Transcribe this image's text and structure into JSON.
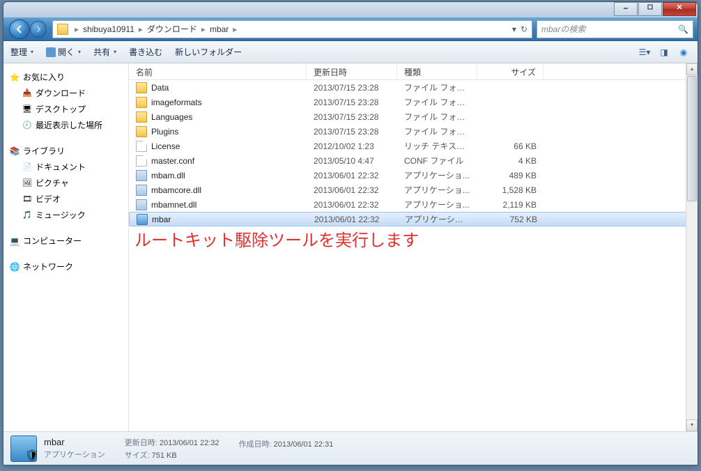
{
  "breadcrumbs": [
    "shibuya10911",
    "ダウンロード",
    "mbar"
  ],
  "search_placeholder": "mbarの検索",
  "toolbar": {
    "organize": "整理",
    "open": "開く",
    "share": "共有",
    "burn": "書き込む",
    "newfolder": "新しいフォルダー"
  },
  "nav": {
    "fav": {
      "label": "お気に入り",
      "items": [
        "ダウンロード",
        "デスクトップ",
        "最近表示した場所"
      ]
    },
    "lib": {
      "label": "ライブラリ",
      "items": [
        "ドキュメント",
        "ピクチャ",
        "ビデオ",
        "ミュージック"
      ]
    },
    "computer": "コンピューター",
    "network": "ネットワーク"
  },
  "headers": {
    "name": "名前",
    "date": "更新日時",
    "type": "種類",
    "size": "サイズ"
  },
  "files": [
    {
      "name": "Data",
      "date": "2013/07/15 23:28",
      "type": "ファイル フォル...",
      "size": "",
      "icon": "folder"
    },
    {
      "name": "imageformats",
      "date": "2013/07/15 23:28",
      "type": "ファイル フォル...",
      "size": "",
      "icon": "folder"
    },
    {
      "name": "Languages",
      "date": "2013/07/15 23:28",
      "type": "ファイル フォル...",
      "size": "",
      "icon": "folder"
    },
    {
      "name": "Plugins",
      "date": "2013/07/15 23:28",
      "type": "ファイル フォル...",
      "size": "",
      "icon": "folder"
    },
    {
      "name": "License",
      "date": "2012/10/02 1:23",
      "type": "リッチ テキスト ...",
      "size": "66 KB",
      "icon": "file"
    },
    {
      "name": "master.conf",
      "date": "2013/05/10 4:47",
      "type": "CONF ファイル",
      "size": "4 KB",
      "icon": "file"
    },
    {
      "name": "mbam.dll",
      "date": "2013/06/01 22:32",
      "type": "アプリケーショ...",
      "size": "489 KB",
      "icon": "dll"
    },
    {
      "name": "mbamcore.dll",
      "date": "2013/06/01 22:32",
      "type": "アプリケーショ...",
      "size": "1,528 KB",
      "icon": "dll"
    },
    {
      "name": "mbamnet.dll",
      "date": "2013/06/01 22:32",
      "type": "アプリケーショ...",
      "size": "2,119 KB",
      "icon": "dll"
    },
    {
      "name": "mbar",
      "date": "2013/06/01 22:32",
      "type": "アプリケーション",
      "size": "752 KB",
      "icon": "exe",
      "selected": true
    }
  ],
  "overlay": "ルートキット駆除ツールを実行します",
  "details": {
    "name": "mbar",
    "type": "アプリケーション",
    "p1_label": "更新日時:",
    "p1_val": "2013/06/01 22:32",
    "p2_label": "サイズ:",
    "p2_val": "751 KB",
    "p3_label": "作成日時:",
    "p3_val": "2013/06/01 22:31"
  }
}
